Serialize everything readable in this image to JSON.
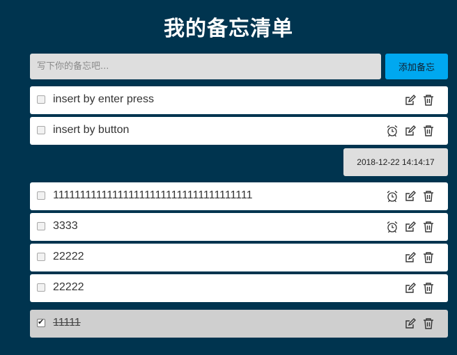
{
  "title": "我的备忘清单",
  "input": {
    "placeholder": "写下你的备忘吧...",
    "value": ""
  },
  "add_button_label": "添加备忘",
  "reminder_time": "2018-12-22 14:14:17",
  "items": [
    {
      "text": "insert by enter press",
      "checked": false,
      "alarm": false
    },
    {
      "text": "insert by button",
      "checked": false,
      "alarm": true
    },
    {
      "text": "1111111111111111111111111111111111111",
      "checked": false,
      "alarm": true
    },
    {
      "text": "3333",
      "checked": false,
      "alarm": true
    },
    {
      "text": "22222",
      "checked": false,
      "alarm": false
    },
    {
      "text": "22222",
      "checked": false,
      "alarm": false
    },
    {
      "text": "11111",
      "checked": true,
      "alarm": false
    }
  ],
  "colors": {
    "background": "#00344f",
    "accent": "#00a8f0",
    "done_item": "#cfcfcf"
  },
  "icons": {
    "edit": "edit-icon",
    "delete": "trash-icon",
    "alarm": "alarm-clock-icon"
  }
}
